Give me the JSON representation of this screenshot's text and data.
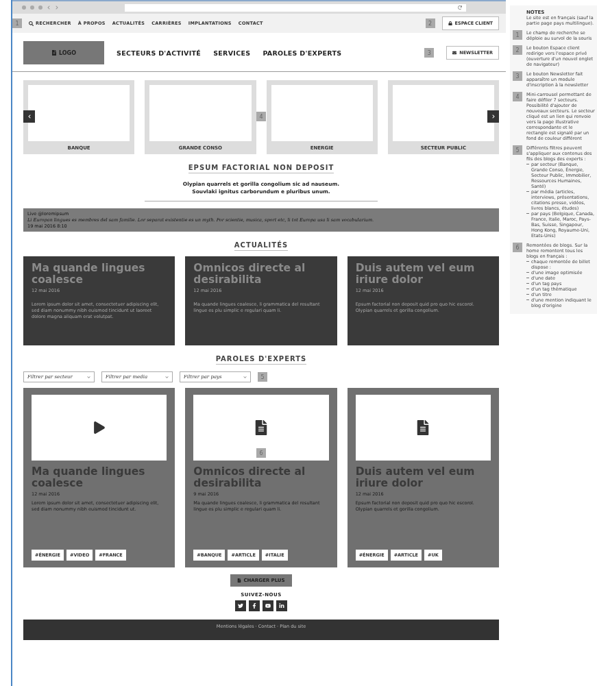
{
  "top_nav": {
    "marker": "1",
    "items": [
      {
        "label": "RECHERCHER",
        "kind": "search"
      },
      {
        "label": "À PROPOS",
        "kind": "link"
      },
      {
        "label": "ACTUALITÉS",
        "kind": "link"
      },
      {
        "label": "CARRIÈRES",
        "kind": "link"
      },
      {
        "label": "IMPLANTATIONS",
        "kind": "link"
      },
      {
        "label": "CONTACT",
        "kind": "link"
      }
    ],
    "client_marker": "2",
    "client_button": "ESPACE CLIENT"
  },
  "header": {
    "logo": "LOGO",
    "nav": [
      "SECTEURS D'ACTIVITÉ",
      "SERVICES",
      "PAROLES D'EXPERTS"
    ],
    "marker": "3",
    "newsletter": "NEWSLETTER"
  },
  "carousel": {
    "marker": "4",
    "sectors": [
      "BANQUE",
      "GRANDE CONSO",
      "ENERGIE",
      "SECTEUR PUBLIC"
    ]
  },
  "intro": {
    "title": "EPSUM FACTORIAL NON DEPOSIT",
    "lines": [
      "Olypian quarrels et gorilla congolium sic ad nauseum.",
      "Souvlaki ignitus carborundum e pluribus unum."
    ]
  },
  "tweet": {
    "handle": "Live @loremipsum",
    "text": "Li Europan lingues es membres del sam familie. Lor separat existentie es un myth. Por scientie, musica, sport etc, li tot Europa usa li sam vocabularium.",
    "date": "19 mai 2016 8:10"
  },
  "news": {
    "title": "ACTUALITÉS",
    "cards": [
      {
        "title": "Ma quande lingues coalesce",
        "date": "12 mai 2016",
        "text": "Lorem ipsum dolor sit amet, consectetuer adipiscing elit, sed diam nonummy nibh euismod tincidunt ut laoreet dolore magna aliquam erat volutpat."
      },
      {
        "title": "Omnicos directe al desirabilita",
        "date": "12 mai 2016",
        "text": "Ma quande lingues coalesce, li grammatica del resultant lingue es plu simplic e regulari quam li."
      },
      {
        "title": "Duis autem vel eum iriure dolor",
        "date": "12 mai 2016",
        "text": "Epsum factorial non deposit quid pro quo hic escorol. Olypian quarrels et gorilla congolium."
      }
    ]
  },
  "experts": {
    "title": "PAROLES D'EXPERTS",
    "filters": [
      "Filtrer par secteur",
      "Filtrer par media",
      "Filtrer par pays"
    ],
    "marker": "5",
    "cards": [
      {
        "kind": "video",
        "title": "Ma quande lingues coalesce",
        "date": "12 mai 2016",
        "text": "Lorem ipsum dolor sit amet, consectetuer adipiscing elit, sed diam nonummy nibh euismod tincidunt ut.",
        "tags": [
          "#ÉNERGIE",
          "#VIDEO",
          "#FRANCE"
        ]
      },
      {
        "kind": "document",
        "marker": "6",
        "title": "Omnicos directe al desirabilita",
        "date": "9 mai 2016",
        "text": "Ma quande lingues coalesce, li grammatica del resultant lingue es plu simplic e regulari quam li.",
        "tags": [
          "#BANQUE",
          "#ARTICLE",
          "#ITALIE"
        ]
      },
      {
        "kind": "document",
        "title": "Duis autem vel eum iriure dolor",
        "date": "12 mai 2016",
        "text": "Epsum factorial non deposit quid pro quo hic escorol. Olypian quarrels et gorilla congolium.",
        "tags": [
          "#ÉNERGIE",
          "#ARTICLE",
          "#UK"
        ]
      }
    ],
    "load_more": "CHARGER PLUS"
  },
  "follow": {
    "title": "SUIVEZ-NOUS",
    "networks": [
      {
        "kind": "twitter"
      },
      {
        "kind": "facebook"
      },
      {
        "kind": "video"
      },
      {
        "kind": "linkedin"
      }
    ]
  },
  "footer": {
    "text": "Mentions légales · Contact · Plan du site"
  },
  "notes": {
    "title": "NOTES",
    "intro": "Le site est en français (sauf la partie page pays multilingue).",
    "items": [
      {
        "marker": "1",
        "text": "Le champ de recherche se déploie au survol de la souris"
      },
      {
        "marker": "2",
        "text": "Le bouton Espace client redirige vers l'espace privé (ouverture d'un nouvel onglet de navigateur)"
      },
      {
        "marker": "3",
        "text": "Le bouton Newsletter fait apparaître un module d'inscription à la newsletter"
      },
      {
        "marker": "4",
        "text": "Mini-carrousel permettant de faire défiler 7 secteurs. Possibilité d'ajouter de nouveaux secteurs. Le secteur cliqué est un lien qui renvoie vers la page illustrative correspondante et le rectangle est signalé par un fond de couleur différent"
      },
      {
        "marker": "5",
        "text": "Différents filtres peuvent s'appliquer aux contenus des fils des blogs des experts :",
        "bullets": [
          "par secteur (Banque, Grande Conso, Énergie, Secteur Public, Immobilier, Ressources Humaines, Santé)",
          "par média (articles, interviews, présentations, citations presse, vidéos, livres blancs, études)",
          "par pays (Belgique, Canada, France, Italie, Maroc, Pays-Bas, Suisse, Singapour, Hong Kong, Royaume-Uni, Etats-Unis)"
        ]
      },
      {
        "marker": "6",
        "text": "Remontées de blogs. Sur la home remontent tous les blogs en français :",
        "bullets": [
          "chaque remontée de billet dispose :",
          "d'une image optimisée",
          "d'une date",
          "d'un tag pays",
          "d'un tag thématique",
          "d'un titre",
          "d'une mention indiquant le blog d'origine"
        ]
      }
    ]
  }
}
